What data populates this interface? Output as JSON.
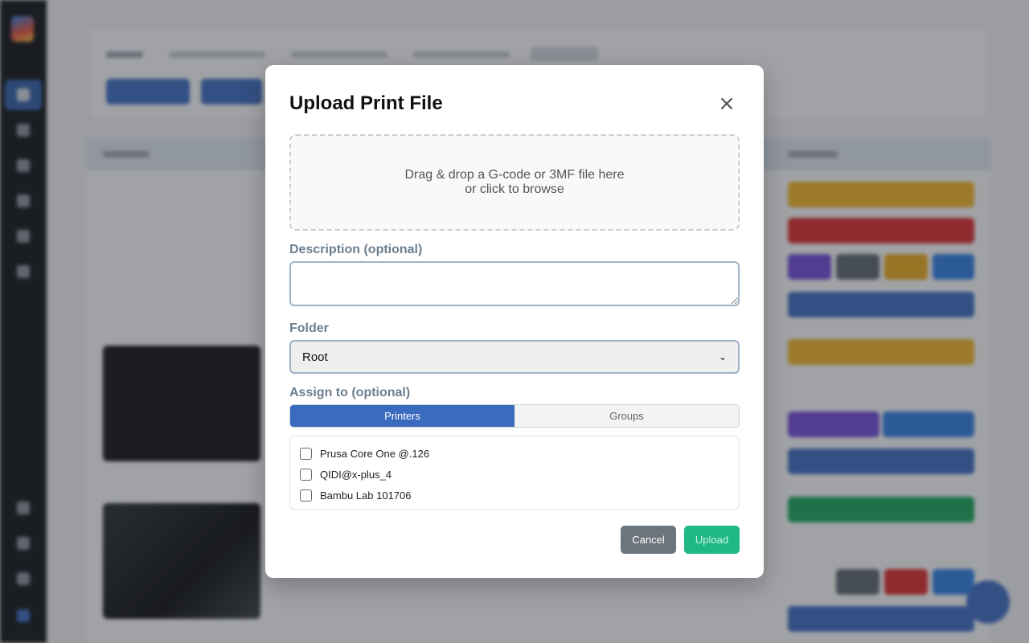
{
  "modal": {
    "title": "Upload Print File",
    "close_icon": "×",
    "dropzone": {
      "line1": "Drag & drop a G-code or 3MF file here",
      "line2": "or click to browse"
    },
    "description": {
      "label": "Description (optional)",
      "value": ""
    },
    "folder": {
      "label": "Folder",
      "selected": "Root",
      "caret": "⌄"
    },
    "assign": {
      "label": "Assign to (optional)",
      "tabs": [
        {
          "label": "Printers",
          "active": true
        },
        {
          "label": "Groups",
          "active": false
        }
      ],
      "printers": [
        {
          "name": "Prusa Core One @.126",
          "checked": false
        },
        {
          "name": "QIDI@x-plus_4",
          "checked": false
        },
        {
          "name": "Bambu Lab 101706",
          "checked": false
        }
      ]
    },
    "buttons": {
      "cancel": "Cancel",
      "upload": "Upload"
    }
  },
  "colors": {
    "primary": "#3b6bbf",
    "upload": "#1fb985",
    "cancel": "#6c757d",
    "label": "#6c7f90"
  }
}
